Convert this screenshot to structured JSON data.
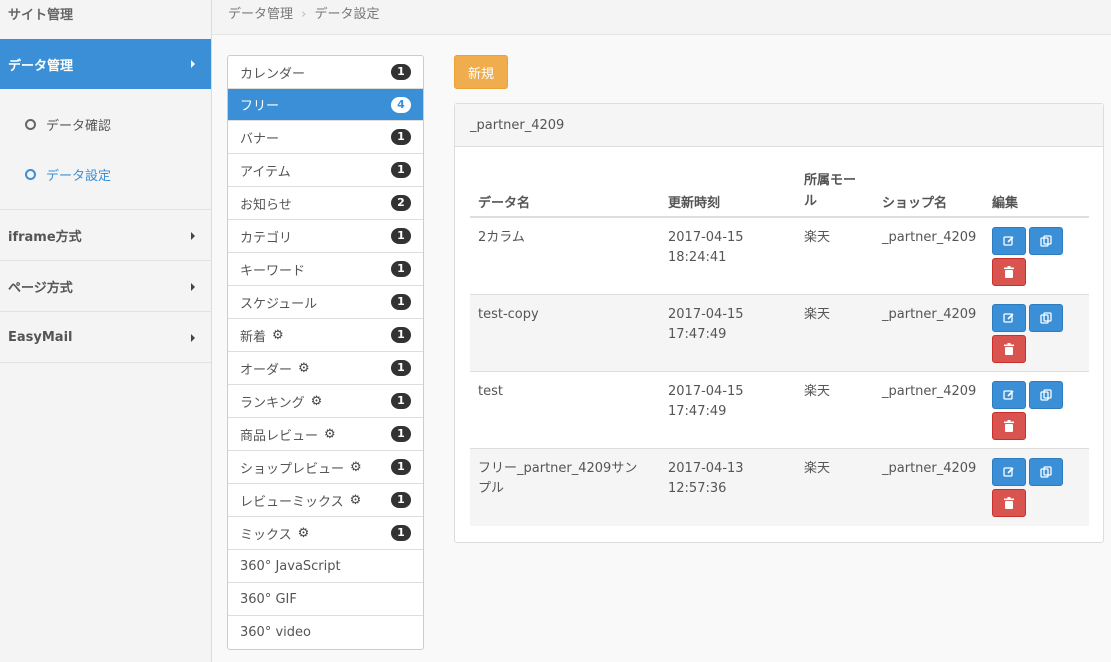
{
  "sidebar": {
    "header": "サイト管理",
    "active_section": "データ管理",
    "sub_items": [
      {
        "label": "データ確認",
        "current": false
      },
      {
        "label": "データ設定",
        "current": true
      }
    ],
    "sections": [
      {
        "label": "iframe方式"
      },
      {
        "label": "ページ方式"
      },
      {
        "label": "EasyMail"
      }
    ]
  },
  "breadcrumb": {
    "parent": "データ管理",
    "separator": "›",
    "current": "データ設定"
  },
  "categories": [
    {
      "label": "カレンダー",
      "count": "1",
      "gear": false,
      "active": false
    },
    {
      "label": "フリー",
      "count": "4",
      "gear": false,
      "active": true
    },
    {
      "label": "バナー",
      "count": "1",
      "gear": false,
      "active": false
    },
    {
      "label": "アイテム",
      "count": "1",
      "gear": false,
      "active": false
    },
    {
      "label": "お知らせ",
      "count": "2",
      "gear": false,
      "active": false
    },
    {
      "label": "カテゴリ",
      "count": "1",
      "gear": false,
      "active": false
    },
    {
      "label": "キーワード",
      "count": "1",
      "gear": false,
      "active": false
    },
    {
      "label": "スケジュール",
      "count": "1",
      "gear": false,
      "active": false
    },
    {
      "label": "新着",
      "count": "1",
      "gear": true,
      "active": false
    },
    {
      "label": "オーダー",
      "count": "1",
      "gear": true,
      "active": false
    },
    {
      "label": "ランキング",
      "count": "1",
      "gear": true,
      "active": false
    },
    {
      "label": "商品レビュー",
      "count": "1",
      "gear": true,
      "active": false
    },
    {
      "label": "ショップレビュー",
      "count": "1",
      "gear": true,
      "active": false
    },
    {
      "label": "レビューミックス",
      "count": "1",
      "gear": true,
      "active": false
    },
    {
      "label": "ミックス",
      "count": "1",
      "gear": true,
      "active": false
    },
    {
      "label": "360° JavaScript",
      "count": null,
      "gear": false,
      "active": false
    },
    {
      "label": "360° GIF",
      "count": null,
      "gear": false,
      "active": false
    },
    {
      "label": "360° video",
      "count": null,
      "gear": false,
      "active": false
    }
  ],
  "new_button": "新規",
  "panel": {
    "title": "_partner_4209",
    "columns": {
      "name": "データ名",
      "updated": "更新時刻",
      "mall": "所属モール",
      "shop": "ショップ名",
      "edit": "編集"
    },
    "rows": [
      {
        "name": "2カラム",
        "date": "2017-04-15",
        "time": "18:24:41",
        "mall": "楽天",
        "shop": "_partner_4209"
      },
      {
        "name": "test-copy",
        "date": "2017-04-15",
        "time": "17:47:49",
        "mall": "楽天",
        "shop": "_partner_4209"
      },
      {
        "name": "test",
        "date": "2017-04-15",
        "time": "17:47:49",
        "mall": "楽天",
        "shop": "_partner_4209"
      },
      {
        "name": "フリー_partner_4209サンプル",
        "date": "2017-04-13",
        "time": "12:57:36",
        "mall": "楽天",
        "shop": "_partner_4209"
      }
    ]
  },
  "colors": {
    "primary": "#3a8fd6",
    "warning": "#f0ad4e",
    "danger": "#d9534f",
    "badge": "#333333"
  },
  "icons": {
    "edit": "edit-icon",
    "copy": "copy-icon",
    "delete": "trash-icon",
    "gear": "gear-icon",
    "radio": "circle-icon",
    "chevron": "chevron-right-icon"
  }
}
